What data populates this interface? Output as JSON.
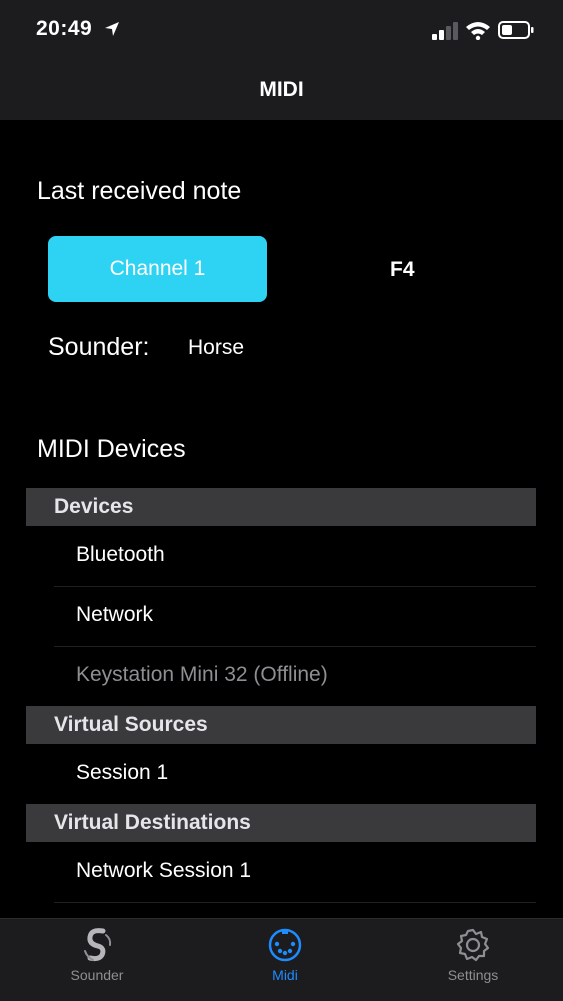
{
  "status_bar": {
    "time": "20:49"
  },
  "nav": {
    "title": "MIDI"
  },
  "last_note": {
    "title": "Last received note",
    "channel_label": "Channel 1",
    "note": "F4",
    "sounder_label": "Sounder:",
    "sounder_value": "Horse"
  },
  "midi_devices": {
    "title": "MIDI Devices",
    "sections": [
      {
        "header": "Devices",
        "items": [
          "Bluetooth",
          "Network",
          "Keystation Mini 32 (Offline)"
        ]
      },
      {
        "header": "Virtual Sources",
        "items": [
          "Session 1"
        ]
      },
      {
        "header": "Virtual Destinations",
        "items": [
          "Network Session 1"
        ]
      }
    ]
  },
  "tabs": [
    {
      "label": "Sounder",
      "icon": "sounder-logo-icon",
      "active": false
    },
    {
      "label": "Midi",
      "icon": "midi-connector-icon",
      "active": true
    },
    {
      "label": "Settings",
      "icon": "gear-icon",
      "active": false
    }
  ],
  "colors": {
    "accent": "#2ED3F4",
    "tab_active": "#1E8BFF",
    "section_bg": "#3A3A3C",
    "bar_bg": "#1C1C1E"
  }
}
